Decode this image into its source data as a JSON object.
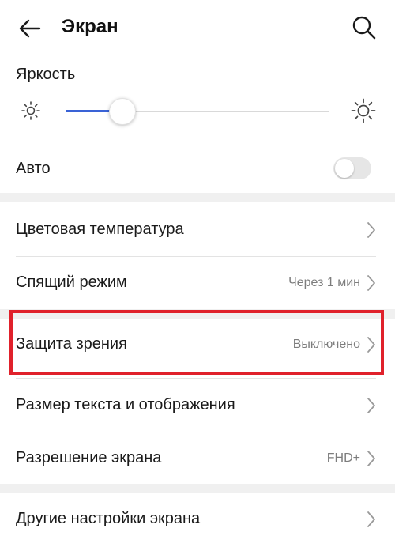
{
  "header": {
    "title": "Экран",
    "back_icon": "arrow-left-icon",
    "search_icon": "search-icon"
  },
  "brightness": {
    "label": "Яркость",
    "level": 0.21,
    "accent_color": "#3a63d6"
  },
  "auto": {
    "label": "Авто",
    "enabled": false
  },
  "items": [
    {
      "label": "Цветовая температура",
      "value": ""
    },
    {
      "label": "Спящий режим",
      "value": "Через 1 мин"
    },
    {
      "label": "Защита зрения",
      "value": "Выключено"
    },
    {
      "label": "Размер текста и отображения",
      "value": ""
    },
    {
      "label": "Разрешение экрана",
      "value": "FHD+"
    },
    {
      "label": "Другие настройки экрана",
      "value": ""
    }
  ],
  "highlight_color": "#e0212b"
}
